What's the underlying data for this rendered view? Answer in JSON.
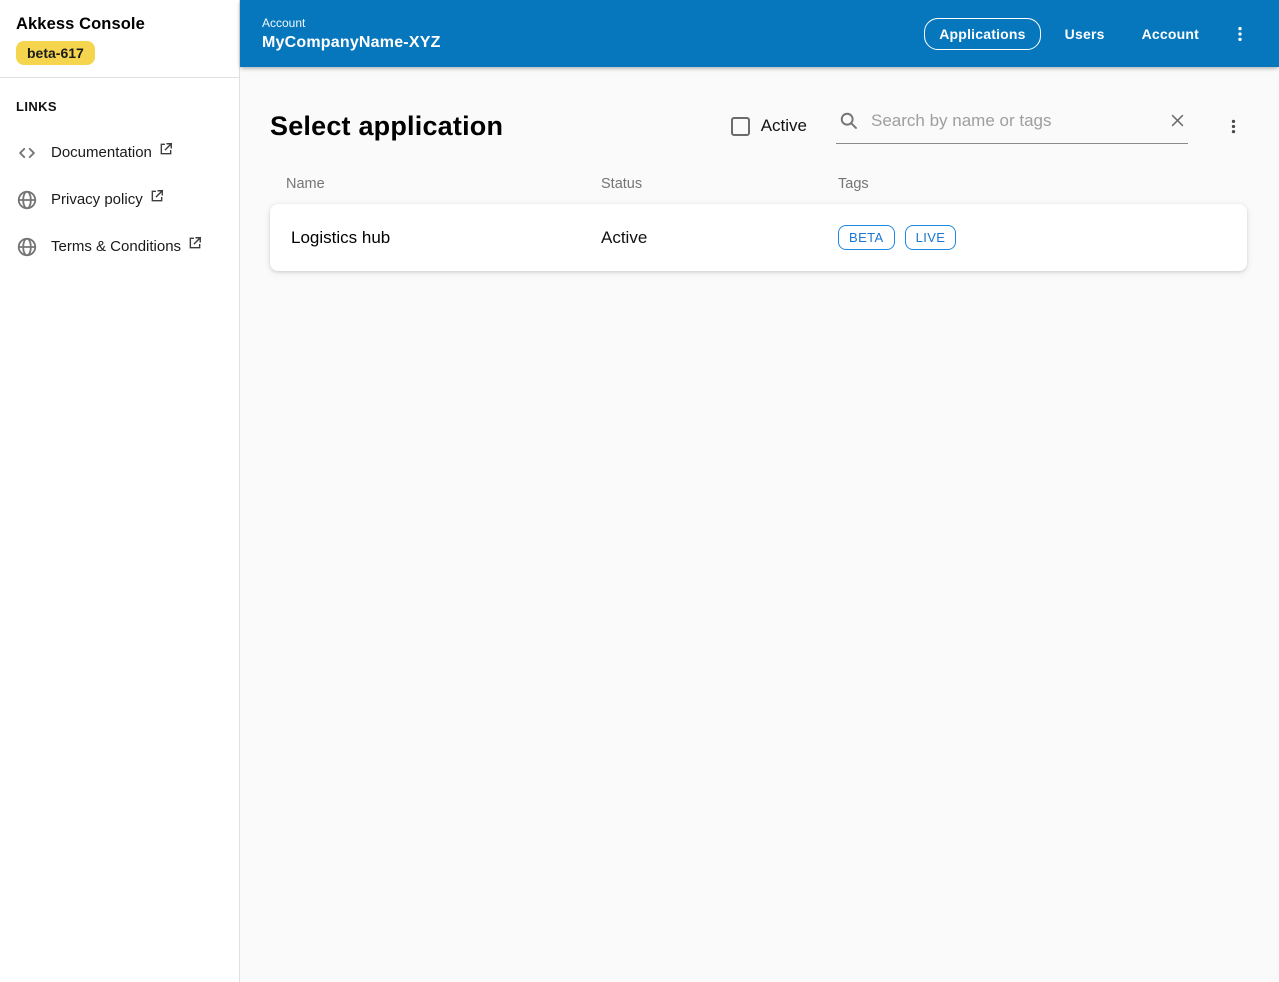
{
  "app": {
    "title": "Akkess Console",
    "badge": "beta-617"
  },
  "sidebar": {
    "links_header": "LINKS",
    "items": [
      {
        "label": "Documentation",
        "icon": "code-icon",
        "external": true
      },
      {
        "label": "Privacy policy",
        "icon": "globe-icon",
        "external": true
      },
      {
        "label": "Terms & Conditions",
        "icon": "globe-icon",
        "external": true
      }
    ]
  },
  "header": {
    "breadcrumb": "Account",
    "account_name": "MyCompanyName-XYZ",
    "nav": [
      {
        "label": "Applications",
        "active": true
      },
      {
        "label": "Users",
        "active": false
      },
      {
        "label": "Account",
        "active": false
      }
    ],
    "menu_icon": "kebab-menu-icon"
  },
  "main": {
    "title": "Select application",
    "filter": {
      "label": "Active",
      "checked": false
    },
    "search": {
      "placeholder": "Search by name or tags",
      "value": "",
      "clear_icon": "close-icon"
    },
    "menu_icon": "kebab-menu-icon",
    "table": {
      "columns": [
        "Name",
        "Status",
        "Tags"
      ],
      "rows": [
        {
          "name": "Logistics hub",
          "status": "Active",
          "tags": [
            "BETA",
            "LIVE"
          ]
        }
      ]
    }
  },
  "colors": {
    "header_blue": "#0777bd",
    "badge_yellow": "#f5d54e",
    "chip_blue": "#1e88e5",
    "content_background": "#fafafa"
  }
}
